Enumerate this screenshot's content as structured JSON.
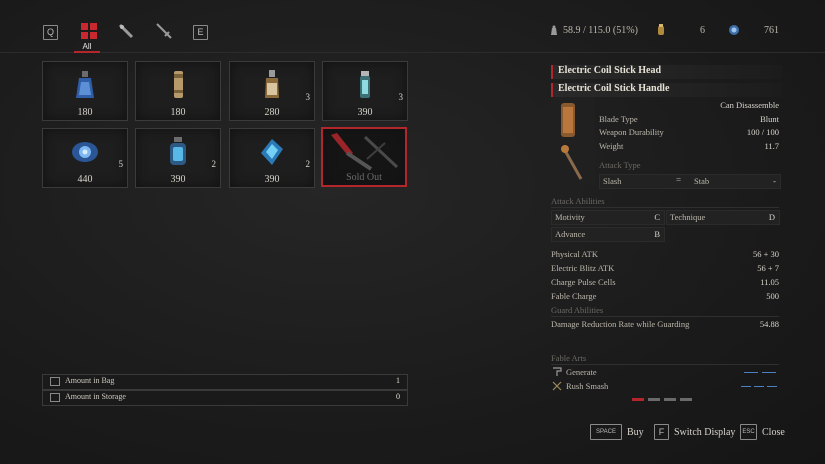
{
  "topbar": {
    "key_prev": "Q",
    "key_next": "E",
    "tab_all_label": "All",
    "weight": "58.9 / 115.0 (51%)",
    "item_count": "6",
    "currency": "761"
  },
  "items": [
    {
      "price": "180",
      "qty": "",
      "icon": "blue-vial-icon"
    },
    {
      "price": "180",
      "qty": "",
      "icon": "cartridge-icon"
    },
    {
      "price": "280",
      "qty": "3",
      "icon": "flask-icon"
    },
    {
      "price": "390",
      "qty": "3",
      "icon": "green-canister-icon"
    },
    {
      "price": "440",
      "qty": "5",
      "icon": "blue-orb-icon"
    },
    {
      "price": "390",
      "qty": "2",
      "icon": "blue-jar-icon"
    },
    {
      "price": "390",
      "qty": "2",
      "icon": "blue-crystal-icon"
    },
    {
      "price": "Sold Out",
      "qty": "",
      "icon": "weapon-handle-icon"
    }
  ],
  "bag": {
    "label": "Amount in Bag",
    "value": "1"
  },
  "storage": {
    "label": "Amount in Storage",
    "value": "0"
  },
  "detail": {
    "head_title": "Electric Coil Stick Head",
    "handle_title": "Electric Coil Stick Handle",
    "can_disassemble": "Can Disassemble",
    "blade_type_label": "Blade Type",
    "blade_type_value": "Blunt",
    "durability_label": "Weapon Durability",
    "durability_value": "100 / 100",
    "weight_label": "Weight",
    "weight_value": "11.7",
    "attack_type_label": "Attack Type",
    "attack_type_1": "Slash",
    "attack_type_sep": "=",
    "attack_type_2": "Stab",
    "attack_type_3": "-",
    "attack_abilities_label": "Attack Abilities",
    "motivity_label": "Motivity",
    "motivity_value": "C",
    "technique_label": "Technique",
    "technique_value": "D",
    "advance_label": "Advance",
    "advance_value": "B",
    "physical_atk_label": "Physical ATK",
    "physical_atk_value": "56 + 30",
    "electric_atk_label": "Electric Blitz ATK",
    "electric_atk_value": "56 + 7",
    "charge_label": "Charge Pulse Cells",
    "charge_value": "11.05",
    "fable_charge_label": "Fable Charge",
    "fable_charge_value": "500",
    "guard_label": "Guard Abilities",
    "damage_reduction_label": "Damage Reduction Rate while Guarding",
    "damage_reduction_value": "54.88",
    "fable_arts_label": "Fable Arts",
    "art_1": "Generate",
    "art_2": "Rush Smash"
  },
  "footer": {
    "buy_key": "SPACE",
    "buy_label": "Buy",
    "switch_key": "F",
    "switch_label": "Switch Display",
    "close_key": "ESC",
    "close_label": "Close"
  },
  "colors": {
    "accent": "#b3272c",
    "art_bar": "#4d7fc1"
  }
}
